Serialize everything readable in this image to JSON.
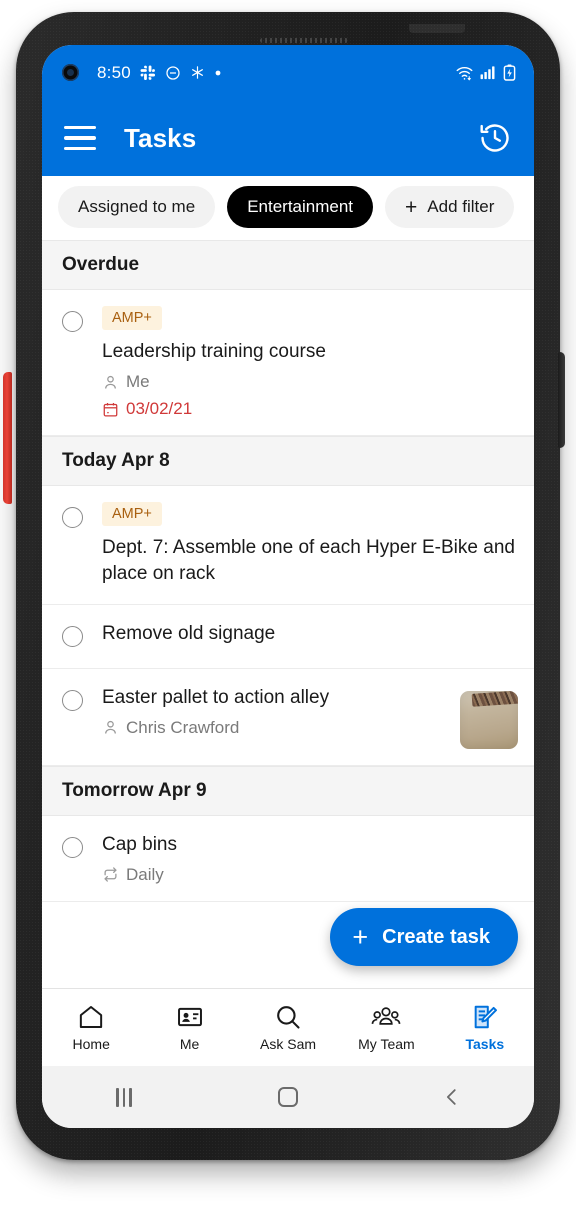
{
  "status_bar": {
    "time": "8:50",
    "left_icons": [
      "camera-hole",
      "slack-icon",
      "do-not-disturb-icon",
      "sparkle-icon",
      "dot-icon"
    ],
    "right_icons": [
      "wifi-icon",
      "cellular-signal-icon",
      "battery-charging-icon"
    ]
  },
  "header": {
    "title": "Tasks",
    "menu_icon": "hamburger-menu-icon",
    "history_icon": "history-clock-icon",
    "background_color": "#0071DC"
  },
  "filters": [
    {
      "label": "Assigned to me",
      "active": false
    },
    {
      "label": "Entertainment",
      "active": true
    },
    {
      "label": "Add filter",
      "active": false,
      "icon": "plus-icon"
    }
  ],
  "sections": [
    {
      "title": "Overdue",
      "tasks": [
        {
          "badge": "AMP+",
          "title": "Leadership training course",
          "assignee": "Me",
          "assignee_icon": "person-icon",
          "due_date": "03/02/21",
          "due_icon": "calendar-icon",
          "due_overdue": true
        }
      ]
    },
    {
      "title": "Today Apr 8",
      "tasks": [
        {
          "badge": "AMP+",
          "title": "Dept. 7: Assemble one of each Hyper E-Bike and place on rack"
        },
        {
          "title": "Remove old signage"
        },
        {
          "title": "Easter pallet to action alley",
          "assignee": "Chris Crawford",
          "assignee_icon": "person-icon",
          "thumbnail": "pallet-photo-thumbnail"
        }
      ]
    },
    {
      "title": "Tomorrow Apr 9",
      "tasks": [
        {
          "title": "Cap bins",
          "recurrence": "Daily",
          "recurrence_icon": "repeat-icon"
        }
      ]
    }
  ],
  "fab": {
    "label": "Create task",
    "icon": "plus-icon",
    "color": "#0071DC"
  },
  "bottom_nav": [
    {
      "label": "Home",
      "icon": "home-icon",
      "active": false
    },
    {
      "label": "Me",
      "icon": "id-badge-icon",
      "active": false
    },
    {
      "label": "Ask Sam",
      "icon": "search-icon",
      "active": false
    },
    {
      "label": "My Team",
      "icon": "people-icon",
      "active": false
    },
    {
      "label": "Tasks",
      "icon": "notepad-pencil-icon",
      "active": true
    }
  ],
  "system_nav": {
    "recents": "recents-icon",
    "home": "home-square-icon",
    "back": "back-chevron-icon"
  },
  "colors": {
    "brand_blue": "#0071DC",
    "overdue_red": "#D03939",
    "badge_bg": "#FDF2DE",
    "badge_text": "#A96010",
    "chip_active_bg": "#000000",
    "chip_inactive_bg": "#F2F2F2"
  }
}
